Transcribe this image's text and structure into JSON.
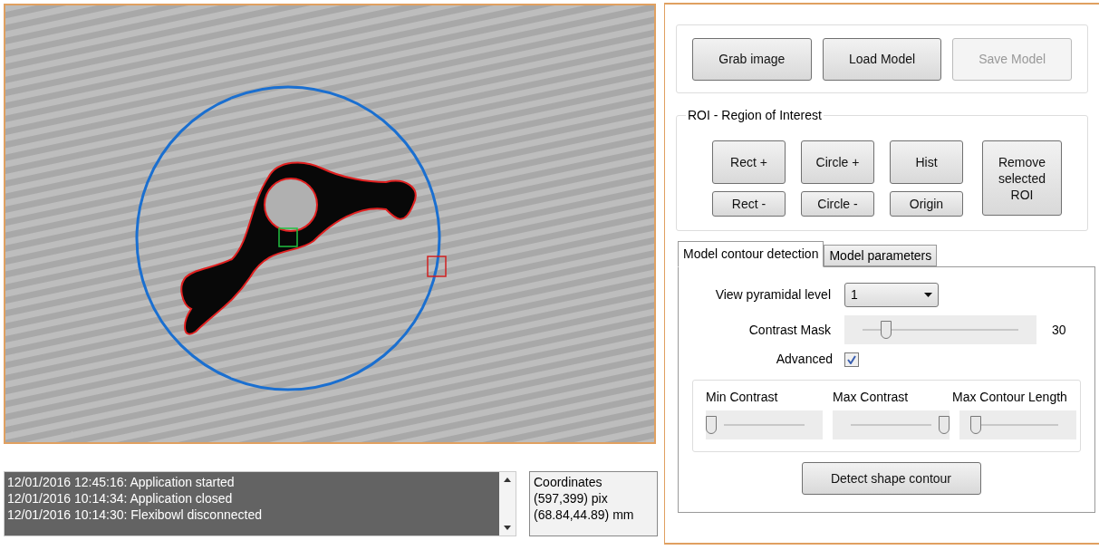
{
  "camera_view": {
    "roi_circle": true,
    "contour_found": true
  },
  "log": {
    "entries": [
      "12/01/2016 12:45:16: Application started",
      "12/01/2016 10:14:34: Application closed",
      "12/01/2016 10:14:30: Flexibowl disconnected"
    ]
  },
  "coordinates": {
    "title": "Coordinates",
    "pixels": "(597,399) pix",
    "millimeters": "(68.84,44.89) mm"
  },
  "model_buttons": [
    {
      "label": "Grab image",
      "disabled": false
    },
    {
      "label": "Load Model",
      "disabled": false
    },
    {
      "label": "Save Model",
      "disabled": true
    }
  ],
  "roi": {
    "title": "ROI - Region of Interest",
    "buttons": [
      {
        "top": "Rect +",
        "bottom": "Rect -"
      },
      {
        "top": "Circle +",
        "bottom": "Circle -"
      },
      {
        "top": "Hist",
        "bottom": "Origin"
      }
    ],
    "remove_button": "Remove selected ROI"
  },
  "tabs": [
    {
      "label": "Model contour detection",
      "selected": true
    },
    {
      "label": "Model parameters",
      "selected": false
    }
  ],
  "contour": {
    "pyramid_label": "View pyramidal level",
    "pyramid_value": "1",
    "contrast": {
      "label": "Contrast Mask",
      "level": 0.2,
      "reading": "30"
    },
    "advanced_label": "Advanced",
    "advanced_checked": true,
    "sliders": [
      {
        "label": "Min Contrast",
        "level": 0
      },
      {
        "label": "Max Contrast",
        "level": 1
      },
      {
        "label": "Max Contour Length",
        "level": 0.1
      }
    ],
    "detect_button": "Detect shape contour"
  }
}
